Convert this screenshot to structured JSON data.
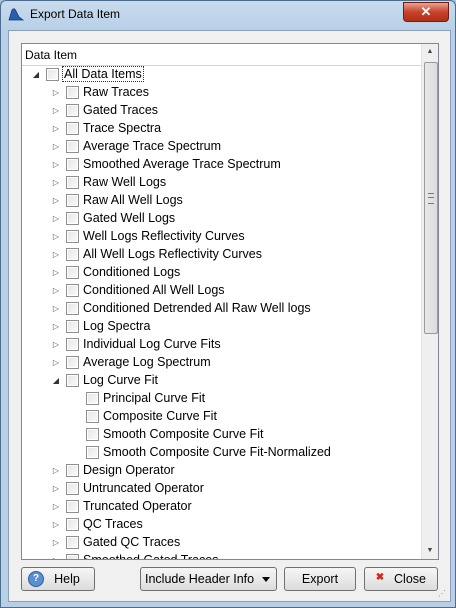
{
  "window": {
    "title": "Export Data Item",
    "close_glyph": "✕"
  },
  "tree": {
    "header": "Data Item",
    "rows": [
      {
        "label": "All Data Items",
        "level": 0,
        "expander": "open",
        "focused": true
      },
      {
        "label": "Raw Traces",
        "level": 1,
        "expander": "closed"
      },
      {
        "label": "Gated Traces",
        "level": 1,
        "expander": "closed"
      },
      {
        "label": "Trace Spectra",
        "level": 1,
        "expander": "closed"
      },
      {
        "label": "Average Trace Spectrum",
        "level": 1,
        "expander": "closed"
      },
      {
        "label": "Smoothed Average Trace Spectrum",
        "level": 1,
        "expander": "closed"
      },
      {
        "label": "Raw Well Logs",
        "level": 1,
        "expander": "closed"
      },
      {
        "label": "Raw All Well Logs",
        "level": 1,
        "expander": "closed"
      },
      {
        "label": "Gated Well Logs",
        "level": 1,
        "expander": "closed"
      },
      {
        "label": "Well Logs Reflectivity Curves",
        "level": 1,
        "expander": "closed"
      },
      {
        "label": "All Well Logs Reflectivity Curves",
        "level": 1,
        "expander": "closed"
      },
      {
        "label": "Conditioned Logs",
        "level": 1,
        "expander": "closed"
      },
      {
        "label": "Conditioned All Well Logs",
        "level": 1,
        "expander": "closed"
      },
      {
        "label": "Conditioned Detrended All Raw Well logs",
        "level": 1,
        "expander": "closed"
      },
      {
        "label": "Log Spectra",
        "level": 1,
        "expander": "closed"
      },
      {
        "label": "Individual Log Curve Fits",
        "level": 1,
        "expander": "closed"
      },
      {
        "label": "Average Log Spectrum",
        "level": 1,
        "expander": "closed"
      },
      {
        "label": "Log Curve Fit",
        "level": 1,
        "expander": "open"
      },
      {
        "label": "Principal Curve Fit",
        "level": 2,
        "expander": "none"
      },
      {
        "label": "Composite Curve Fit",
        "level": 2,
        "expander": "none"
      },
      {
        "label": "Smooth Composite Curve Fit",
        "level": 2,
        "expander": "none"
      },
      {
        "label": "Smooth Composite Curve Fit-Normalized",
        "level": 2,
        "expander": "none"
      },
      {
        "label": "Design Operator",
        "level": 1,
        "expander": "closed"
      },
      {
        "label": "Untruncated Operator",
        "level": 1,
        "expander": "closed"
      },
      {
        "label": "Truncated Operator",
        "level": 1,
        "expander": "closed"
      },
      {
        "label": "QC Traces",
        "level": 1,
        "expander": "closed"
      },
      {
        "label": "Gated QC Traces",
        "level": 1,
        "expander": "closed"
      },
      {
        "label": "Smoothed Gated Traces",
        "level": 1,
        "expander": "closed"
      }
    ]
  },
  "buttons": {
    "help": "Help",
    "include_header": "Include Header Info",
    "export": "Export",
    "close": "Close"
  },
  "colors": {
    "title_bar": "#b8cfe6",
    "close_button": "#c7432b",
    "dialog_bg": "#f0f0f0"
  }
}
